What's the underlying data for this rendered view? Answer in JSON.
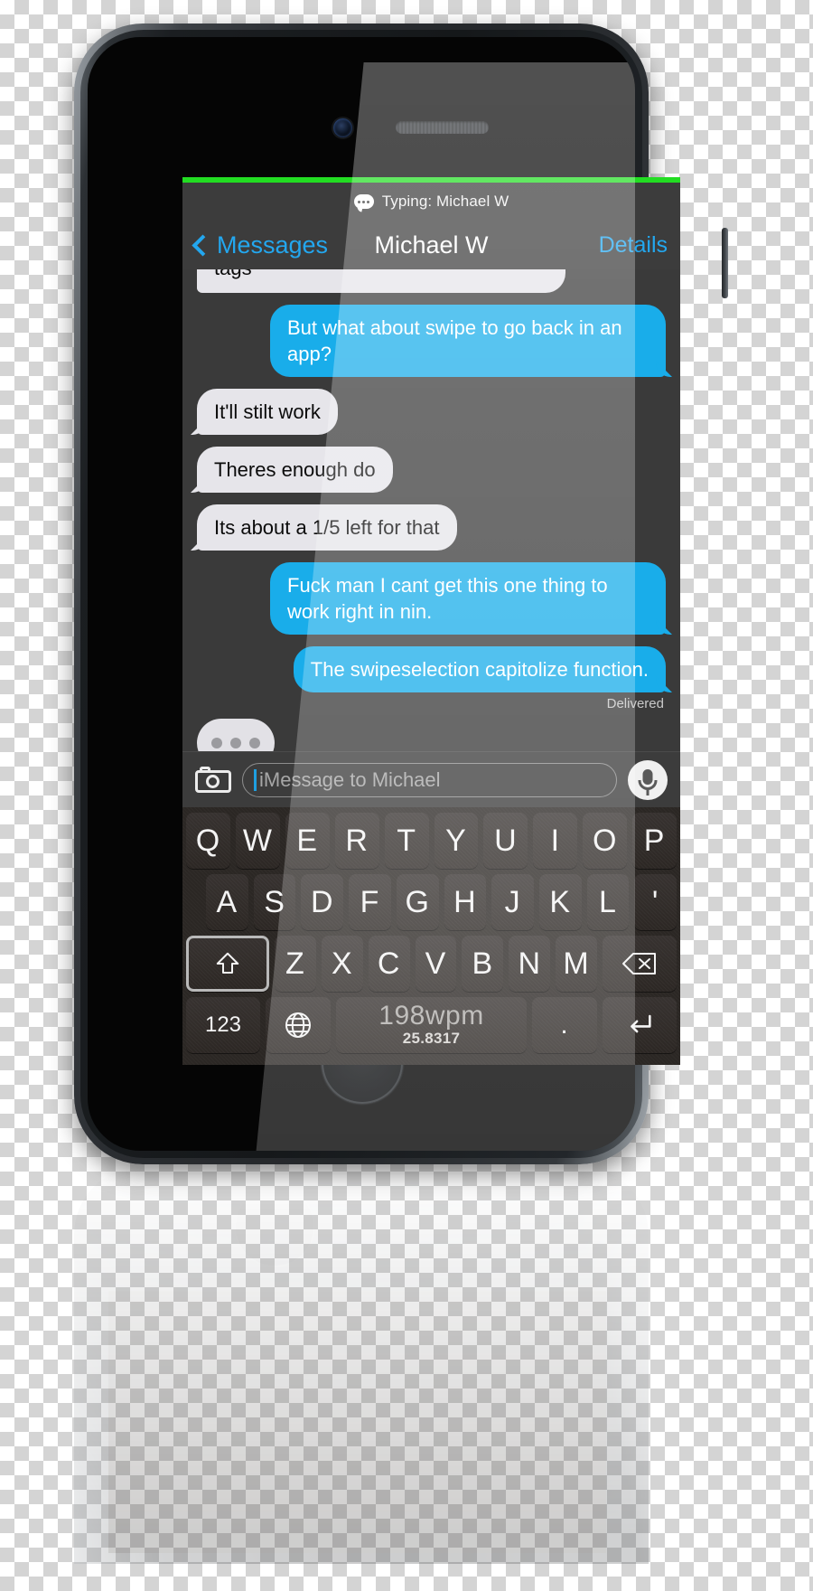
{
  "status_bar": {
    "icon": "message-bubble-icon",
    "text": "Typing: Michael W"
  },
  "nav_bar": {
    "back_label": "Messages",
    "back_icon": "chevron-left-icon",
    "title": "Michael W",
    "details_label": "Details"
  },
  "conversation": {
    "clipped_top_message": "tags",
    "messages": [
      {
        "from": "me",
        "text": "But what about swipe to go back in an app?"
      },
      {
        "from": "them",
        "text": "It'll stilt work"
      },
      {
        "from": "them",
        "text": "Theres enough do"
      },
      {
        "from": "them",
        "text": "Its about a 1/5 left for that"
      },
      {
        "from": "me",
        "text": "Fuck man I cant get this one thing to work right in nin."
      },
      {
        "from": "me",
        "text": "The swipeselection capitolize function."
      }
    ],
    "delivered_label": "Delivered",
    "typing_indicator": "typing-indicator-bubble"
  },
  "input_bar": {
    "camera_icon": "camera-icon",
    "placeholder": "iMessage to Michael",
    "mic_icon": "microphone-icon"
  },
  "keyboard": {
    "row1": [
      "Q",
      "W",
      "E",
      "R",
      "T",
      "Y",
      "U",
      "I",
      "O",
      "P"
    ],
    "row2": [
      "A",
      "S",
      "D",
      "F",
      "G",
      "H",
      "J",
      "K",
      "L",
      "'"
    ],
    "row3": [
      "Z",
      "X",
      "C",
      "V",
      "B",
      "N",
      "M"
    ],
    "shift_icon": "shift-arrow-icon",
    "backspace_icon": "backspace-icon",
    "numbers_label": "123",
    "globe_icon": "globe-icon",
    "space_primary": "198wpm",
    "space_secondary": "25.8317",
    "period_label": ".",
    "return_icon": "return-icon"
  },
  "colors": {
    "accent_blue": "#19adea",
    "link_blue": "#23a7ef",
    "them_bubble": "#e6e5ea",
    "status_green": "#22dd22",
    "screen_bg": "#3a3a3a",
    "keyboard_bg": "#2b2724"
  }
}
